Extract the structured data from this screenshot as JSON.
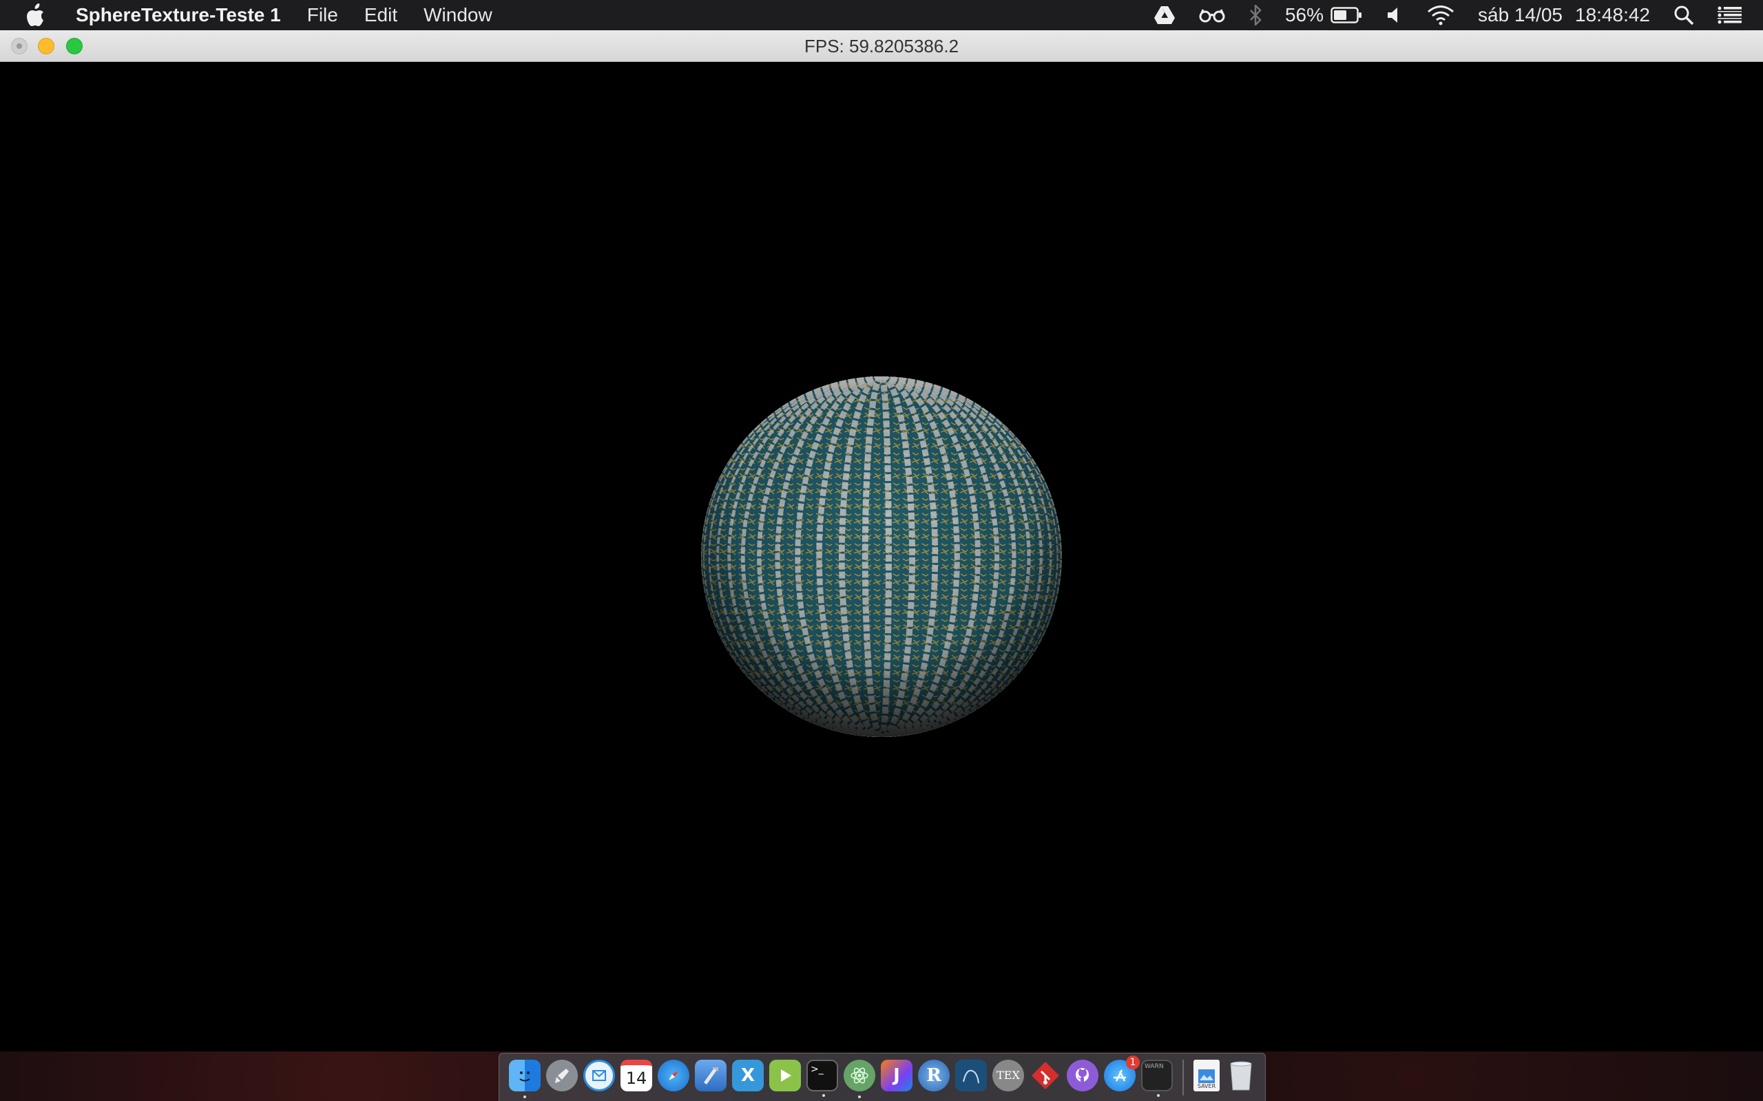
{
  "menubar": {
    "app_name": "SphereTexture-Teste 1",
    "menus": [
      "File",
      "Edit",
      "Window"
    ],
    "status": {
      "battery_percent": "56%",
      "date": "sáb 14/05",
      "time": "18:48:42",
      "icons": [
        "google-drive-icon",
        "glasses-icon",
        "bluetooth-icon",
        "battery-icon",
        "volume-icon",
        "wifi-icon",
        "spotlight-search-icon",
        "notification-center-icon"
      ]
    }
  },
  "window": {
    "title": "FPS: 59.8205386.2"
  },
  "scene": {
    "background": "#000000",
    "sphere_base_color": "#1f5a6a",
    "sphere_stripe_color": "#c8c8c8",
    "sphere_pattern_color": "#b89a3a"
  },
  "dock": {
    "calendar_day": "14",
    "appstore_badge": "1",
    "tex_label": "TEX",
    "saver_label": "SAVER",
    "apps": [
      "finder-icon",
      "launchpad-icon",
      "airmail-icon",
      "calendar-icon",
      "safari-icon",
      "xcode-icon",
      "xamarin-icon",
      "infuse-icon",
      "terminal-icon",
      "atom-icon",
      "jetbrains-icon",
      "r-icon",
      "mysql-workbench-icon",
      "tex-icon",
      "git-icon",
      "github-icon",
      "app-store-icon",
      "console-icon",
      "screensaver-file-icon",
      "trash-icon"
    ]
  }
}
